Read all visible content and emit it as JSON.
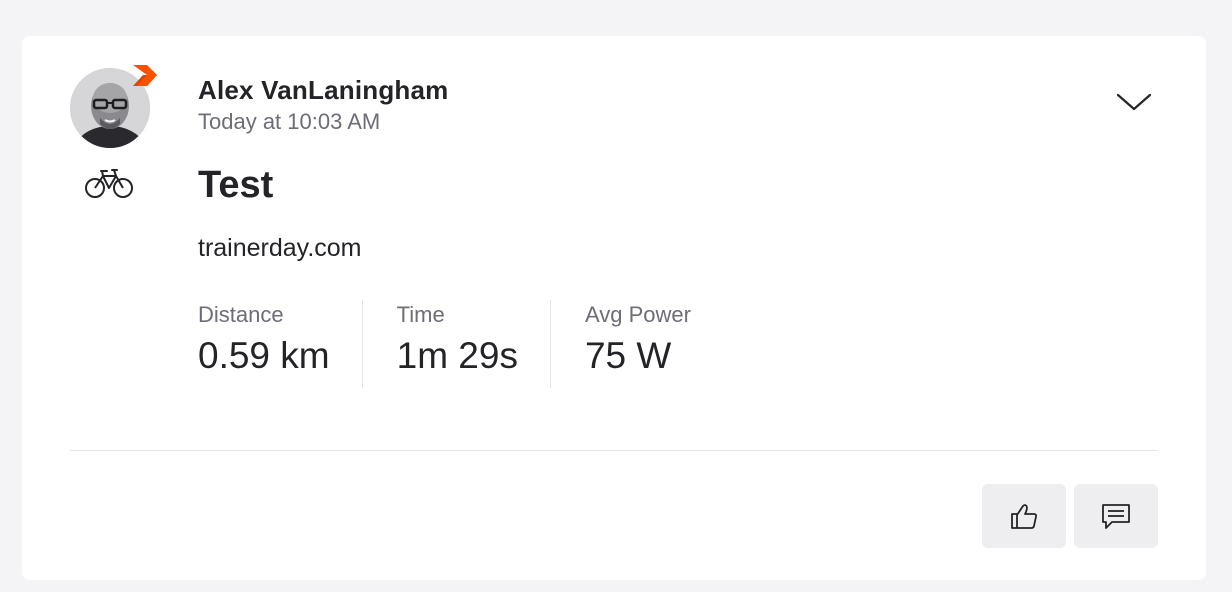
{
  "activity": {
    "athlete_name": "Alex VanLaningham",
    "timestamp": "Today at 10:03 AM",
    "sport_icon": "bike-icon",
    "title": "Test",
    "description": "trainerday.com",
    "stats": [
      {
        "label": "Distance",
        "value": "0.59 km"
      },
      {
        "label": "Time",
        "value": "1m 29s"
      },
      {
        "label": "Avg Power",
        "value": "75 W"
      }
    ]
  },
  "icons": {
    "menu": "chevron-down-icon",
    "kudos": "thumbs-up-icon",
    "comment": "comment-icon",
    "badge": "subscriber-badge-icon"
  },
  "colors": {
    "page_background": "#f4f4f6",
    "card_background": "#ffffff",
    "text_primary": "#242428",
    "text_secondary": "#6d6d78",
    "brand_orange": "#fc5200",
    "button_background": "#eeeef0"
  }
}
